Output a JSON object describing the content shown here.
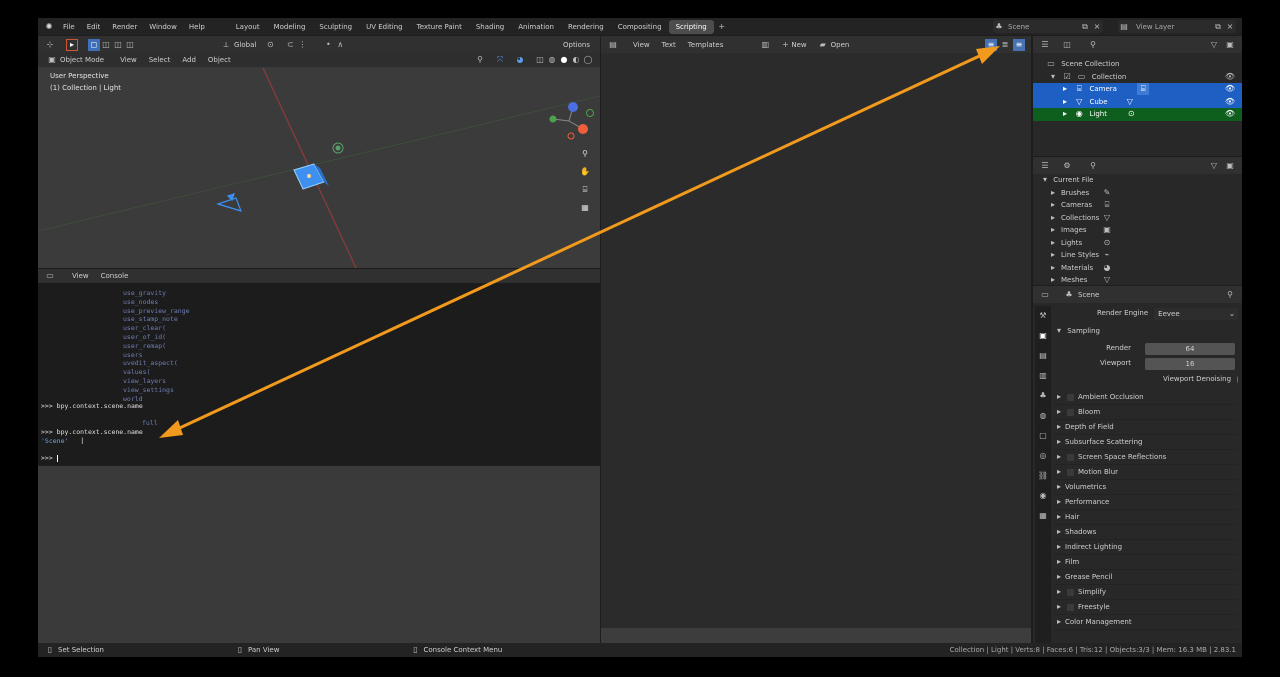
{
  "topbar": {
    "menus": [
      "File",
      "Edit",
      "Render",
      "Window",
      "Help"
    ],
    "workspaces": [
      "Layout",
      "Modeling",
      "Sculpting",
      "UV Editing",
      "Texture Paint",
      "Shading",
      "Animation",
      "Rendering",
      "Compositing",
      "Scripting"
    ],
    "active_workspace": "Scripting",
    "scene_name": "Scene",
    "view_layer": "View Layer"
  },
  "viewport": {
    "orientation": "Global",
    "options_label": "Options",
    "mode": "Object Mode",
    "menus": [
      "View",
      "Select",
      "Add",
      "Object"
    ],
    "overlay_title": "User Perspective",
    "overlay_subtitle": "(1) Collection | Light"
  },
  "console": {
    "menus": [
      "View",
      "Console"
    ],
    "autocomplete": [
      "use_gravity",
      "use_nodes",
      "use_preview_range",
      "use_stamp_note",
      "user_clear(",
      "user_of_id(",
      "user_remap(",
      "users",
      "uvedit_aspect(",
      "values(",
      "view_layers",
      "view_settings",
      "world"
    ],
    "cmd1": ">>> bpy.context.scene.name",
    "full_hint": "full",
    "cmd2": ">>> bpy.context.scene.name",
    "result": "'Scene'",
    "prompt": ">>> "
  },
  "text_editor": {
    "menus": [
      "View",
      "Text",
      "Templates"
    ],
    "new_label": "New",
    "open_label": "Open"
  },
  "outliner": {
    "root": "Scene Collection",
    "collection": "Collection",
    "items": [
      "Camera",
      "Cube",
      "Light"
    ]
  },
  "data_browser": {
    "root": "Current File",
    "items": [
      "Brushes",
      "Cameras",
      "Collections",
      "Images",
      "Lights",
      "Line Styles",
      "Materials",
      "Meshes"
    ]
  },
  "properties": {
    "scene_label": "Scene",
    "render_engine_label": "Render Engine",
    "render_engine_value": "Eevee",
    "sampling_label": "Sampling",
    "render_label": "Render",
    "render_value": "64",
    "viewport_label": "Viewport",
    "viewport_value": "16",
    "denoise_label": "Viewport Denoising",
    "panels": [
      "Ambient Occlusion",
      "Bloom",
      "Depth of Field",
      "Subsurface Scattering",
      "Screen Space Reflections",
      "Motion Blur",
      "Volumetrics",
      "Performance",
      "Hair",
      "Shadows",
      "Indirect Lighting",
      "Film",
      "Grease Pencil",
      "Simplify",
      "Freestyle",
      "Color Management"
    ]
  },
  "statusbar": {
    "set_selection": "Set Selection",
    "pan_view": "Pan View",
    "context_menu": "Console Context Menu",
    "stats": "Collection | Light | Verts:8 | Faces:6 | Tris:12 | Objects:3/3 | Mem: 16.3 MB | 2.83.1"
  },
  "colors": {
    "accent": "#4772b3",
    "selected_row": "#1e5fc4",
    "active_row": "#0e5e1e",
    "arrow": "#f19a1d",
    "object_blue": "#3d8ff0"
  }
}
